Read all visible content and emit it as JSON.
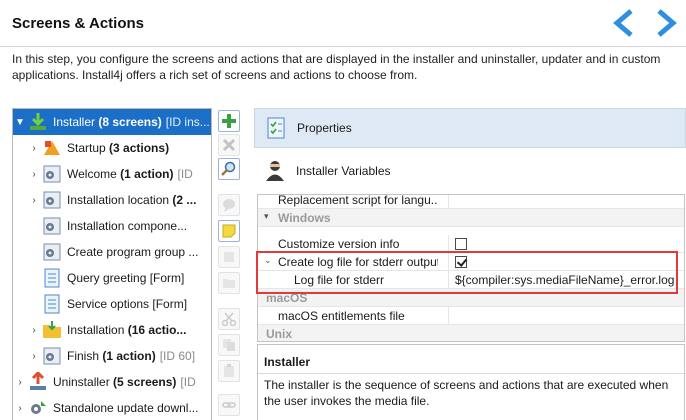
{
  "header": {
    "title": "Screens & Actions",
    "intro": "In this step, you configure the screens and actions that are displayed in the installer and uninstaller, updater and in custom applications. Install4j offers a rich set of screens and actions to choose from."
  },
  "tree": {
    "items": [
      {
        "label": "Installer",
        "bold": "(8 screens)",
        "meta": "[ID ins...",
        "expanded": true,
        "selected": true
      },
      {
        "label": "Startup",
        "bold": "(3 actions)",
        "meta": ""
      },
      {
        "label": "Welcome",
        "bold": "(1 action)",
        "meta": "[ID"
      },
      {
        "label": "Installation location",
        "bold": "(2 ...",
        "meta": ""
      },
      {
        "label": "Installation compone...",
        "bold": "",
        "meta": ""
      },
      {
        "label": "Create program group ...",
        "bold": "",
        "meta": ""
      },
      {
        "label": "Query greeting [Form]",
        "bold": "",
        "meta": ""
      },
      {
        "label": "Service options [Form]",
        "bold": "",
        "meta": ""
      },
      {
        "label": "Installation",
        "bold": "(16 actio...",
        "meta": ""
      },
      {
        "label": "Finish",
        "bold": "(1 action)",
        "meta": "[ID 60]"
      },
      {
        "label": "Uninstaller",
        "bold": "(5 screens)",
        "meta": "[ID"
      },
      {
        "label": "Standalone update downl...",
        "bold": "",
        "meta": ""
      }
    ]
  },
  "panel": {
    "properties_label": "Properties",
    "variables_label": "Installer Variables"
  },
  "grid": {
    "rows": [
      {
        "name": "Replacement script for langu...",
        "value": ""
      },
      {
        "category": "Windows"
      },
      {
        "name": "Customize version info",
        "check": false
      },
      {
        "name": "Create log file for stderr output",
        "check": true,
        "expanded": true
      },
      {
        "name": "Log file for stderr",
        "value": "${compiler:sys.mediaFileName}_error.log",
        "indent": true
      },
      {
        "category": "macOS"
      },
      {
        "name": "macOS entitlements file",
        "value": ""
      },
      {
        "category": "Unix"
      }
    ]
  },
  "description": {
    "title": "Installer",
    "text": "The installer is the sequence of screens and actions that are executed when the user invokes the media file."
  },
  "colors": {
    "accent": "#1b6fc7",
    "nav_arrow": "#2f8ee0",
    "highlight": "#e03a3a"
  }
}
